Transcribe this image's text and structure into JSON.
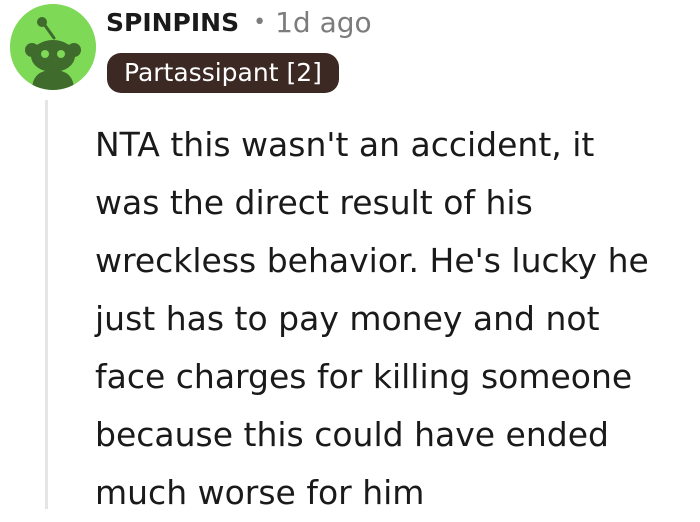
{
  "comment": {
    "author": {
      "username": "SPINPINS",
      "avatar_icon": "reddit-snoo-avatar-icon",
      "avatar_color": "#7ed957"
    },
    "separator": "•",
    "timestamp": "1d ago",
    "flair": {
      "label": "Partassipant [2]",
      "background": "#3c2924",
      "color": "#ffffff"
    },
    "body_lines": [
      "NTA this wasn't an accident, it",
      "was the direct result of his",
      "wreckless behavior. He's lucky he",
      "just has to pay money and not",
      "face charges for killing someone",
      "because this could have ended",
      "much worse for him"
    ]
  }
}
